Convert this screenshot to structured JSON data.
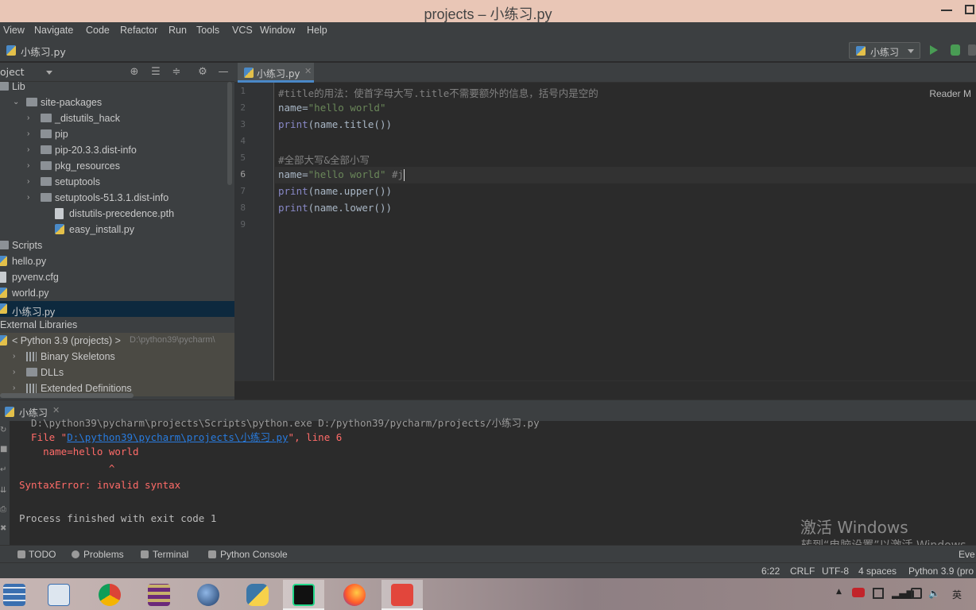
{
  "window": {
    "title": "projects – 小练习.py"
  },
  "menu": [
    "View",
    "Navigate",
    "Code",
    "Refactor",
    "Run",
    "Tools",
    "VCS",
    "Window",
    "Help"
  ],
  "breadcrumb": "小练习.py",
  "run_config": "小练习",
  "project_panel": {
    "title": "oject"
  },
  "tree": [
    {
      "label": "Lib",
      "indent": 0,
      "kind": "folder"
    },
    {
      "label": "site-packages",
      "indent": 1,
      "kind": "folder",
      "arrow": "open"
    },
    {
      "label": "_distutils_hack",
      "indent": 2,
      "kind": "folder",
      "arrow": "closed"
    },
    {
      "label": "pip",
      "indent": 2,
      "kind": "folder",
      "arrow": "closed"
    },
    {
      "label": "pip-20.3.3.dist-info",
      "indent": 2,
      "kind": "folder",
      "arrow": "closed"
    },
    {
      "label": "pkg_resources",
      "indent": 2,
      "kind": "folder",
      "arrow": "closed"
    },
    {
      "label": "setuptools",
      "indent": 2,
      "kind": "folder",
      "arrow": "closed"
    },
    {
      "label": "setuptools-51.3.1.dist-info",
      "indent": 2,
      "kind": "folder",
      "arrow": "closed"
    },
    {
      "label": "distutils-precedence.pth",
      "indent": 3,
      "kind": "file"
    },
    {
      "label": "easy_install.py",
      "indent": 3,
      "kind": "py"
    },
    {
      "label": "Scripts",
      "indent": 0,
      "kind": "folder"
    },
    {
      "label": "hello.py",
      "indent": 0,
      "kind": "py"
    },
    {
      "label": "pyvenv.cfg",
      "indent": 0,
      "kind": "file"
    },
    {
      "label": "world.py",
      "indent": 0,
      "kind": "py"
    },
    {
      "label": "小练习.py",
      "indent": 0,
      "kind": "py",
      "selected": true
    },
    {
      "label": "External Libraries",
      "indent": 0,
      "kind": "none"
    },
    {
      "label": "< Python 3.9 (projects) >",
      "path": "D:\\python39\\pycharm\\",
      "indent": 0,
      "kind": "py",
      "lib": true
    },
    {
      "label": "Binary Skeletons",
      "indent": 1,
      "kind": "bars",
      "arrow": "closed",
      "lib": true
    },
    {
      "label": "DLLs",
      "indent": 1,
      "kind": "folder",
      "arrow": "closed",
      "lib": true
    },
    {
      "label": "Extended Definitions",
      "indent": 1,
      "kind": "bars",
      "arrow": "closed",
      "lib": true
    }
  ],
  "editor": {
    "tab": "小练习.py",
    "reader_mode": "Reader M",
    "current_line": 6,
    "lines": [
      {
        "n": "1",
        "parts": [
          {
            "c": "cm",
            "t": "#title的用法：使首字母大写.title不需要额外的信息，括号内是空的"
          }
        ]
      },
      {
        "n": "2",
        "parts": [
          {
            "c": "id",
            "t": "name="
          },
          {
            "c": "str",
            "t": "\"hello world\""
          }
        ]
      },
      {
        "n": "3",
        "parts": [
          {
            "c": "kw",
            "t": "print"
          },
          {
            "c": "id",
            "t": "(name.title())"
          }
        ]
      },
      {
        "n": "4",
        "parts": []
      },
      {
        "n": "5",
        "parts": [
          {
            "c": "cm",
            "t": "#全部大写&全部小写"
          }
        ]
      },
      {
        "n": "6",
        "parts": [
          {
            "c": "id",
            "t": "name="
          },
          {
            "c": "str",
            "t": "\"hello world\""
          },
          {
            "c": "cm",
            "t": " #j"
          }
        ],
        "caret": true
      },
      {
        "n": "7",
        "parts": [
          {
            "c": "kw",
            "t": "print"
          },
          {
            "c": "id",
            "t": "(name.upper())"
          }
        ]
      },
      {
        "n": "8",
        "parts": [
          {
            "c": "kw",
            "t": "print"
          },
          {
            "c": "id",
            "t": "(name.lower())"
          }
        ]
      },
      {
        "n": "9",
        "parts": []
      }
    ]
  },
  "run_panel": {
    "tab": "小练习",
    "output": {
      "truncated": "  D:\\python39\\pycharm\\projects\\Scripts\\python.exe D:/python39/pycharm/projects/小练习.py",
      "file_prefix": "  File \"",
      "file_link": "D:\\python39\\pycharm\\projects\\小练习.py",
      "file_suffix": "\", line 6",
      "code_line": "    name=hello world",
      "caret_line": "               ^",
      "error": "SyntaxError: invalid syntax",
      "exit": "Process finished with exit code 1"
    },
    "watermark_title": "激活 Windows",
    "watermark_sub": "转到“电脑设置”以激活 Windows。"
  },
  "tool_windows": [
    "TODO",
    "Problems",
    "Terminal",
    "Python Console"
  ],
  "event_log": "Eve",
  "status": {
    "position": "6:22",
    "line_sep": "CRLF",
    "encoding": "UTF-8",
    "indent": "4 spaces",
    "interpreter": "Python 3.9 (pro"
  },
  "taskbar": {
    "ime": "英",
    "apps": [
      "windows-start",
      "stocks",
      "chrome",
      "archive",
      "cinema4d",
      "python",
      "pycharm",
      "firefox",
      "recorder"
    ]
  },
  "colors": {
    "accent": "#4a88c7",
    "error": "#ff6b68",
    "string": "#6a8759",
    "selection": "#0d293e"
  }
}
